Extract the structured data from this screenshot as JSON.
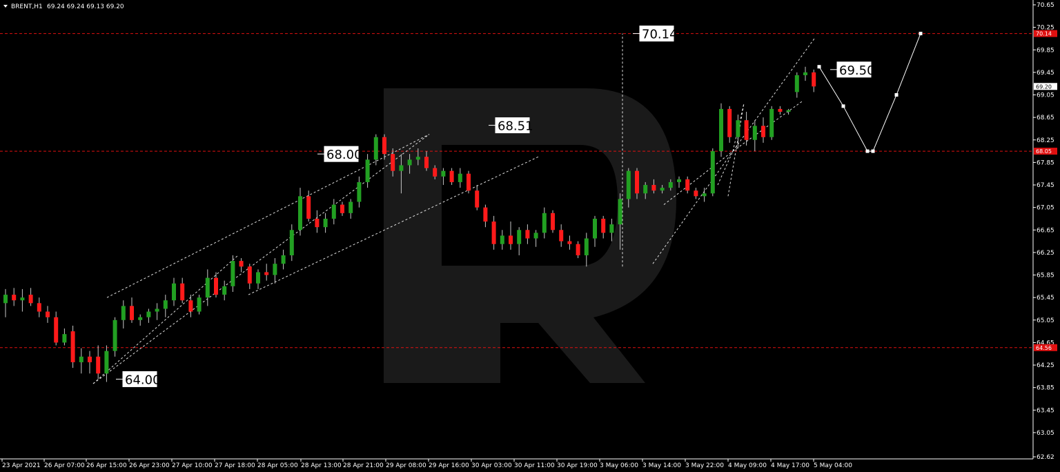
{
  "header": {
    "symbol": "BRENT,H1",
    "ohlc": "69.24 69.24 69.13 69.20"
  },
  "colors": {
    "background": "#000000",
    "bull": "#22a022",
    "bear": "#ff1a1a",
    "wick": "#c8c8c8",
    "level_line": "#e01010",
    "current_price_tag": "#ffffff",
    "watermark": "#1a1a1a"
  },
  "chart_data": {
    "type": "candlestick",
    "ylim": [
      62.62,
      70.65
    ],
    "y_ticks": [
      "70.65",
      "70.25",
      "69.85",
      "69.45",
      "69.05",
      "68.65",
      "68.25",
      "67.85",
      "67.45",
      "67.05",
      "66.65",
      "66.25",
      "65.85",
      "65.45",
      "65.05",
      "64.65",
      "64.25",
      "63.85",
      "63.45",
      "63.05",
      "62.62"
    ],
    "x_labels": [
      "23 Apr 2021",
      "26 Apr 07:00",
      "26 Apr 15:00",
      "26 Apr 23:00",
      "27 Apr 10:00",
      "27 Apr 18:00",
      "28 Apr 05:00",
      "28 Apr 13:00",
      "28 Apr 21:00",
      "29 Apr 08:00",
      "29 Apr 16:00",
      "30 Apr 03:00",
      "30 Apr 11:00",
      "30 Apr 19:00",
      "3 May 06:00",
      "3 May 14:00",
      "3 May 22:00",
      "4 May 09:00",
      "4 May 17:00",
      "5 May 04:00"
    ],
    "grid": false,
    "current_price": "69.20",
    "horizontal_levels": [
      {
        "value": 70.14,
        "tag": "70.14"
      },
      {
        "value": 68.05,
        "tag": "68.05"
      },
      {
        "value": 64.56,
        "tag": "64.56"
      }
    ],
    "level_labels": [
      {
        "text": "64.00",
        "x": 14,
        "y": 64.0
      },
      {
        "text": "68.00",
        "x": 74,
        "y": 68.0
      },
      {
        "text": "68.51",
        "x": 112,
        "y": 68.51
      },
      {
        "text": "70.14",
        "x": 147,
        "y": 70.14
      },
      {
        "text": "69.50",
        "x": 198,
        "y": 69.5
      }
    ],
    "candles": [
      {
        "i": 0,
        "o": 65.35,
        "h": 65.6,
        "l": 65.1,
        "c": 65.5
      },
      {
        "i": 1,
        "o": 65.5,
        "h": 65.62,
        "l": 65.3,
        "c": 65.4
      },
      {
        "i": 2,
        "o": 65.4,
        "h": 65.6,
        "l": 65.2,
        "c": 65.45
      },
      {
        "i": 3,
        "o": 65.5,
        "h": 65.62,
        "l": 65.3,
        "c": 65.35
      },
      {
        "i": 4,
        "o": 65.35,
        "h": 65.45,
        "l": 65.1,
        "c": 65.2
      },
      {
        "i": 5,
        "o": 65.2,
        "h": 65.3,
        "l": 65.0,
        "c": 65.1
      },
      {
        "i": 6,
        "o": 65.1,
        "h": 65.2,
        "l": 64.6,
        "c": 64.65
      },
      {
        "i": 7,
        "o": 64.65,
        "h": 64.9,
        "l": 64.6,
        "c": 64.8
      },
      {
        "i": 8,
        "o": 64.85,
        "h": 64.95,
        "l": 64.2,
        "c": 64.3
      },
      {
        "i": 9,
        "o": 64.3,
        "h": 64.55,
        "l": 64.1,
        "c": 64.4
      },
      {
        "i": 10,
        "o": 64.4,
        "h": 64.5,
        "l": 64.1,
        "c": 64.3
      },
      {
        "i": 11,
        "o": 64.4,
        "h": 64.6,
        "l": 64.0,
        "c": 64.1
      },
      {
        "i": 12,
        "o": 64.1,
        "h": 64.6,
        "l": 63.95,
        "c": 64.5
      },
      {
        "i": 13,
        "o": 64.5,
        "h": 65.1,
        "l": 64.4,
        "c": 65.05
      },
      {
        "i": 14,
        "o": 65.05,
        "h": 65.4,
        "l": 64.9,
        "c": 65.3
      },
      {
        "i": 15,
        "o": 65.3,
        "h": 65.45,
        "l": 65.0,
        "c": 65.05
      },
      {
        "i": 16,
        "o": 65.05,
        "h": 65.15,
        "l": 64.95,
        "c": 65.1
      },
      {
        "i": 17,
        "o": 65.1,
        "h": 65.25,
        "l": 65.0,
        "c": 65.2
      },
      {
        "i": 18,
        "o": 65.2,
        "h": 65.35,
        "l": 65.05,
        "c": 65.25
      },
      {
        "i": 19,
        "o": 65.25,
        "h": 65.5,
        "l": 65.1,
        "c": 65.4
      },
      {
        "i": 20,
        "o": 65.4,
        "h": 65.8,
        "l": 65.3,
        "c": 65.7
      },
      {
        "i": 21,
        "o": 65.7,
        "h": 65.8,
        "l": 65.35,
        "c": 65.4
      },
      {
        "i": 22,
        "o": 65.4,
        "h": 65.5,
        "l": 65.1,
        "c": 65.2
      },
      {
        "i": 23,
        "o": 65.2,
        "h": 65.5,
        "l": 65.15,
        "c": 65.45
      },
      {
        "i": 24,
        "o": 65.45,
        "h": 65.95,
        "l": 65.3,
        "c": 65.8
      },
      {
        "i": 25,
        "o": 65.8,
        "h": 65.9,
        "l": 65.45,
        "c": 65.5
      },
      {
        "i": 26,
        "o": 65.5,
        "h": 65.75,
        "l": 65.4,
        "c": 65.65
      },
      {
        "i": 27,
        "o": 65.65,
        "h": 66.2,
        "l": 65.55,
        "c": 66.1
      },
      {
        "i": 28,
        "o": 66.1,
        "h": 66.15,
        "l": 65.9,
        "c": 66.0
      },
      {
        "i": 29,
        "o": 66.0,
        "h": 66.05,
        "l": 65.6,
        "c": 65.7
      },
      {
        "i": 30,
        "o": 65.7,
        "h": 65.95,
        "l": 65.6,
        "c": 65.9
      },
      {
        "i": 31,
        "o": 65.9,
        "h": 66.05,
        "l": 65.75,
        "c": 65.85
      },
      {
        "i": 32,
        "o": 65.85,
        "h": 66.15,
        "l": 65.7,
        "c": 66.05
      },
      {
        "i": 33,
        "o": 66.05,
        "h": 66.3,
        "l": 65.95,
        "c": 66.2
      },
      {
        "i": 34,
        "o": 66.2,
        "h": 66.75,
        "l": 66.1,
        "c": 66.65
      },
      {
        "i": 35,
        "o": 66.65,
        "h": 67.4,
        "l": 66.55,
        "c": 67.25
      },
      {
        "i": 36,
        "o": 67.25,
        "h": 67.35,
        "l": 66.8,
        "c": 66.85
      },
      {
        "i": 37,
        "o": 66.85,
        "h": 67.0,
        "l": 66.6,
        "c": 66.7
      },
      {
        "i": 38,
        "o": 66.7,
        "h": 66.95,
        "l": 66.6,
        "c": 66.85
      },
      {
        "i": 39,
        "o": 66.85,
        "h": 67.2,
        "l": 66.75,
        "c": 67.1
      },
      {
        "i": 40,
        "o": 67.1,
        "h": 67.15,
        "l": 66.9,
        "c": 66.95
      },
      {
        "i": 41,
        "o": 66.95,
        "h": 67.2,
        "l": 66.85,
        "c": 67.15
      },
      {
        "i": 42,
        "o": 67.15,
        "h": 67.6,
        "l": 67.05,
        "c": 67.5
      },
      {
        "i": 43,
        "o": 67.5,
        "h": 68.0,
        "l": 67.4,
        "c": 67.9
      },
      {
        "i": 44,
        "o": 67.9,
        "h": 68.35,
        "l": 67.8,
        "c": 68.3
      },
      {
        "i": 45,
        "o": 68.3,
        "h": 68.35,
        "l": 67.9,
        "c": 68.0
      },
      {
        "i": 46,
        "o": 68.0,
        "h": 68.1,
        "l": 67.6,
        "c": 67.7
      },
      {
        "i": 47,
        "o": 67.7,
        "h": 68.0,
        "l": 67.3,
        "c": 67.8
      },
      {
        "i": 48,
        "o": 67.8,
        "h": 68.0,
        "l": 67.65,
        "c": 67.9
      },
      {
        "i": 49,
        "o": 67.9,
        "h": 68.1,
        "l": 67.8,
        "c": 67.95
      },
      {
        "i": 50,
        "o": 67.95,
        "h": 68.05,
        "l": 67.7,
        "c": 67.75
      },
      {
        "i": 51,
        "o": 67.75,
        "h": 67.8,
        "l": 67.55,
        "c": 67.6
      },
      {
        "i": 52,
        "o": 67.6,
        "h": 67.75,
        "l": 67.45,
        "c": 67.7
      },
      {
        "i": 53,
        "o": 67.7,
        "h": 67.75,
        "l": 67.45,
        "c": 67.5
      },
      {
        "i": 54,
        "o": 67.5,
        "h": 67.75,
        "l": 67.4,
        "c": 67.65
      },
      {
        "i": 55,
        "o": 67.65,
        "h": 67.7,
        "l": 67.3,
        "c": 67.35
      },
      {
        "i": 56,
        "o": 67.35,
        "h": 67.45,
        "l": 67.0,
        "c": 67.05
      },
      {
        "i": 57,
        "o": 67.05,
        "h": 67.1,
        "l": 66.7,
        "c": 66.8
      },
      {
        "i": 58,
        "o": 66.8,
        "h": 66.9,
        "l": 66.3,
        "c": 66.4
      },
      {
        "i": 59,
        "o": 66.4,
        "h": 66.65,
        "l": 66.3,
        "c": 66.55
      },
      {
        "i": 60,
        "o": 66.55,
        "h": 66.8,
        "l": 66.3,
        "c": 66.4
      },
      {
        "i": 61,
        "o": 66.4,
        "h": 66.7,
        "l": 66.2,
        "c": 66.65
      },
      {
        "i": 62,
        "o": 66.65,
        "h": 66.75,
        "l": 66.4,
        "c": 66.5
      },
      {
        "i": 63,
        "o": 66.5,
        "h": 66.65,
        "l": 66.35,
        "c": 66.6
      },
      {
        "i": 64,
        "o": 66.6,
        "h": 67.05,
        "l": 66.5,
        "c": 66.95
      },
      {
        "i": 65,
        "o": 66.95,
        "h": 67.0,
        "l": 66.6,
        "c": 66.65
      },
      {
        "i": 66,
        "o": 66.65,
        "h": 66.75,
        "l": 66.35,
        "c": 66.45
      },
      {
        "i": 67,
        "o": 66.45,
        "h": 66.55,
        "l": 66.3,
        "c": 66.4
      },
      {
        "i": 68,
        "o": 66.4,
        "h": 66.45,
        "l": 66.15,
        "c": 66.2
      },
      {
        "i": 69,
        "o": 66.2,
        "h": 66.6,
        "l": 66.0,
        "c": 66.5
      },
      {
        "i": 70,
        "o": 66.5,
        "h": 66.9,
        "l": 66.35,
        "c": 66.85
      },
      {
        "i": 71,
        "o": 66.85,
        "h": 66.9,
        "l": 66.5,
        "c": 66.6
      },
      {
        "i": 72,
        "o": 66.6,
        "h": 66.85,
        "l": 66.45,
        "c": 66.75
      },
      {
        "i": 73,
        "o": 66.75,
        "h": 67.3,
        "l": 66.3,
        "c": 67.2
      },
      {
        "i": 74,
        "o": 67.2,
        "h": 67.75,
        "l": 67.05,
        "c": 67.7
      },
      {
        "i": 75,
        "o": 67.7,
        "h": 67.75,
        "l": 67.2,
        "c": 67.3
      },
      {
        "i": 76,
        "o": 67.3,
        "h": 67.5,
        "l": 67.2,
        "c": 67.45
      },
      {
        "i": 77,
        "o": 67.45,
        "h": 67.55,
        "l": 67.3,
        "c": 67.35
      },
      {
        "i": 78,
        "o": 67.35,
        "h": 67.45,
        "l": 67.3,
        "c": 67.4
      },
      {
        "i": 79,
        "o": 67.4,
        "h": 67.55,
        "l": 67.35,
        "c": 67.5
      },
      {
        "i": 80,
        "o": 67.5,
        "h": 67.6,
        "l": 67.4,
        "c": 67.55
      },
      {
        "i": 81,
        "o": 67.55,
        "h": 67.6,
        "l": 67.3,
        "c": 67.35
      },
      {
        "i": 82,
        "o": 67.35,
        "h": 67.4,
        "l": 67.2,
        "c": 67.25
      },
      {
        "i": 83,
        "o": 67.25,
        "h": 67.4,
        "l": 67.15,
        "c": 67.3
      },
      {
        "i": 84,
        "o": 67.3,
        "h": 68.1,
        "l": 67.25,
        "c": 68.05
      },
      {
        "i": 85,
        "o": 68.05,
        "h": 68.9,
        "l": 67.95,
        "c": 68.8
      },
      {
        "i": 86,
        "o": 68.8,
        "h": 68.85,
        "l": 68.2,
        "c": 68.3
      },
      {
        "i": 87,
        "o": 68.3,
        "h": 68.7,
        "l": 68.1,
        "c": 68.6
      },
      {
        "i": 88,
        "o": 68.6,
        "h": 68.75,
        "l": 68.15,
        "c": 68.25
      },
      {
        "i": 89,
        "o": 68.25,
        "h": 68.6,
        "l": 68.05,
        "c": 68.5
      },
      {
        "i": 90,
        "o": 68.5,
        "h": 68.65,
        "l": 68.2,
        "c": 68.3
      },
      {
        "i": 91,
        "o": 68.3,
        "h": 68.85,
        "l": 68.25,
        "c": 68.8
      },
      {
        "i": 92,
        "o": 68.8,
        "h": 68.85,
        "l": 68.7,
        "c": 68.75
      },
      {
        "i": 93,
        "o": 68.75,
        "h": 68.8,
        "l": 68.7,
        "c": 68.78
      },
      {
        "i": 94,
        "o": 69.1,
        "h": 69.45,
        "l": 69.0,
        "c": 69.4
      },
      {
        "i": 95,
        "o": 69.4,
        "h": 69.55,
        "l": 69.3,
        "c": 69.45
      },
      {
        "i": 96,
        "o": 69.45,
        "h": 69.5,
        "l": 69.1,
        "c": 69.2
      }
    ]
  }
}
